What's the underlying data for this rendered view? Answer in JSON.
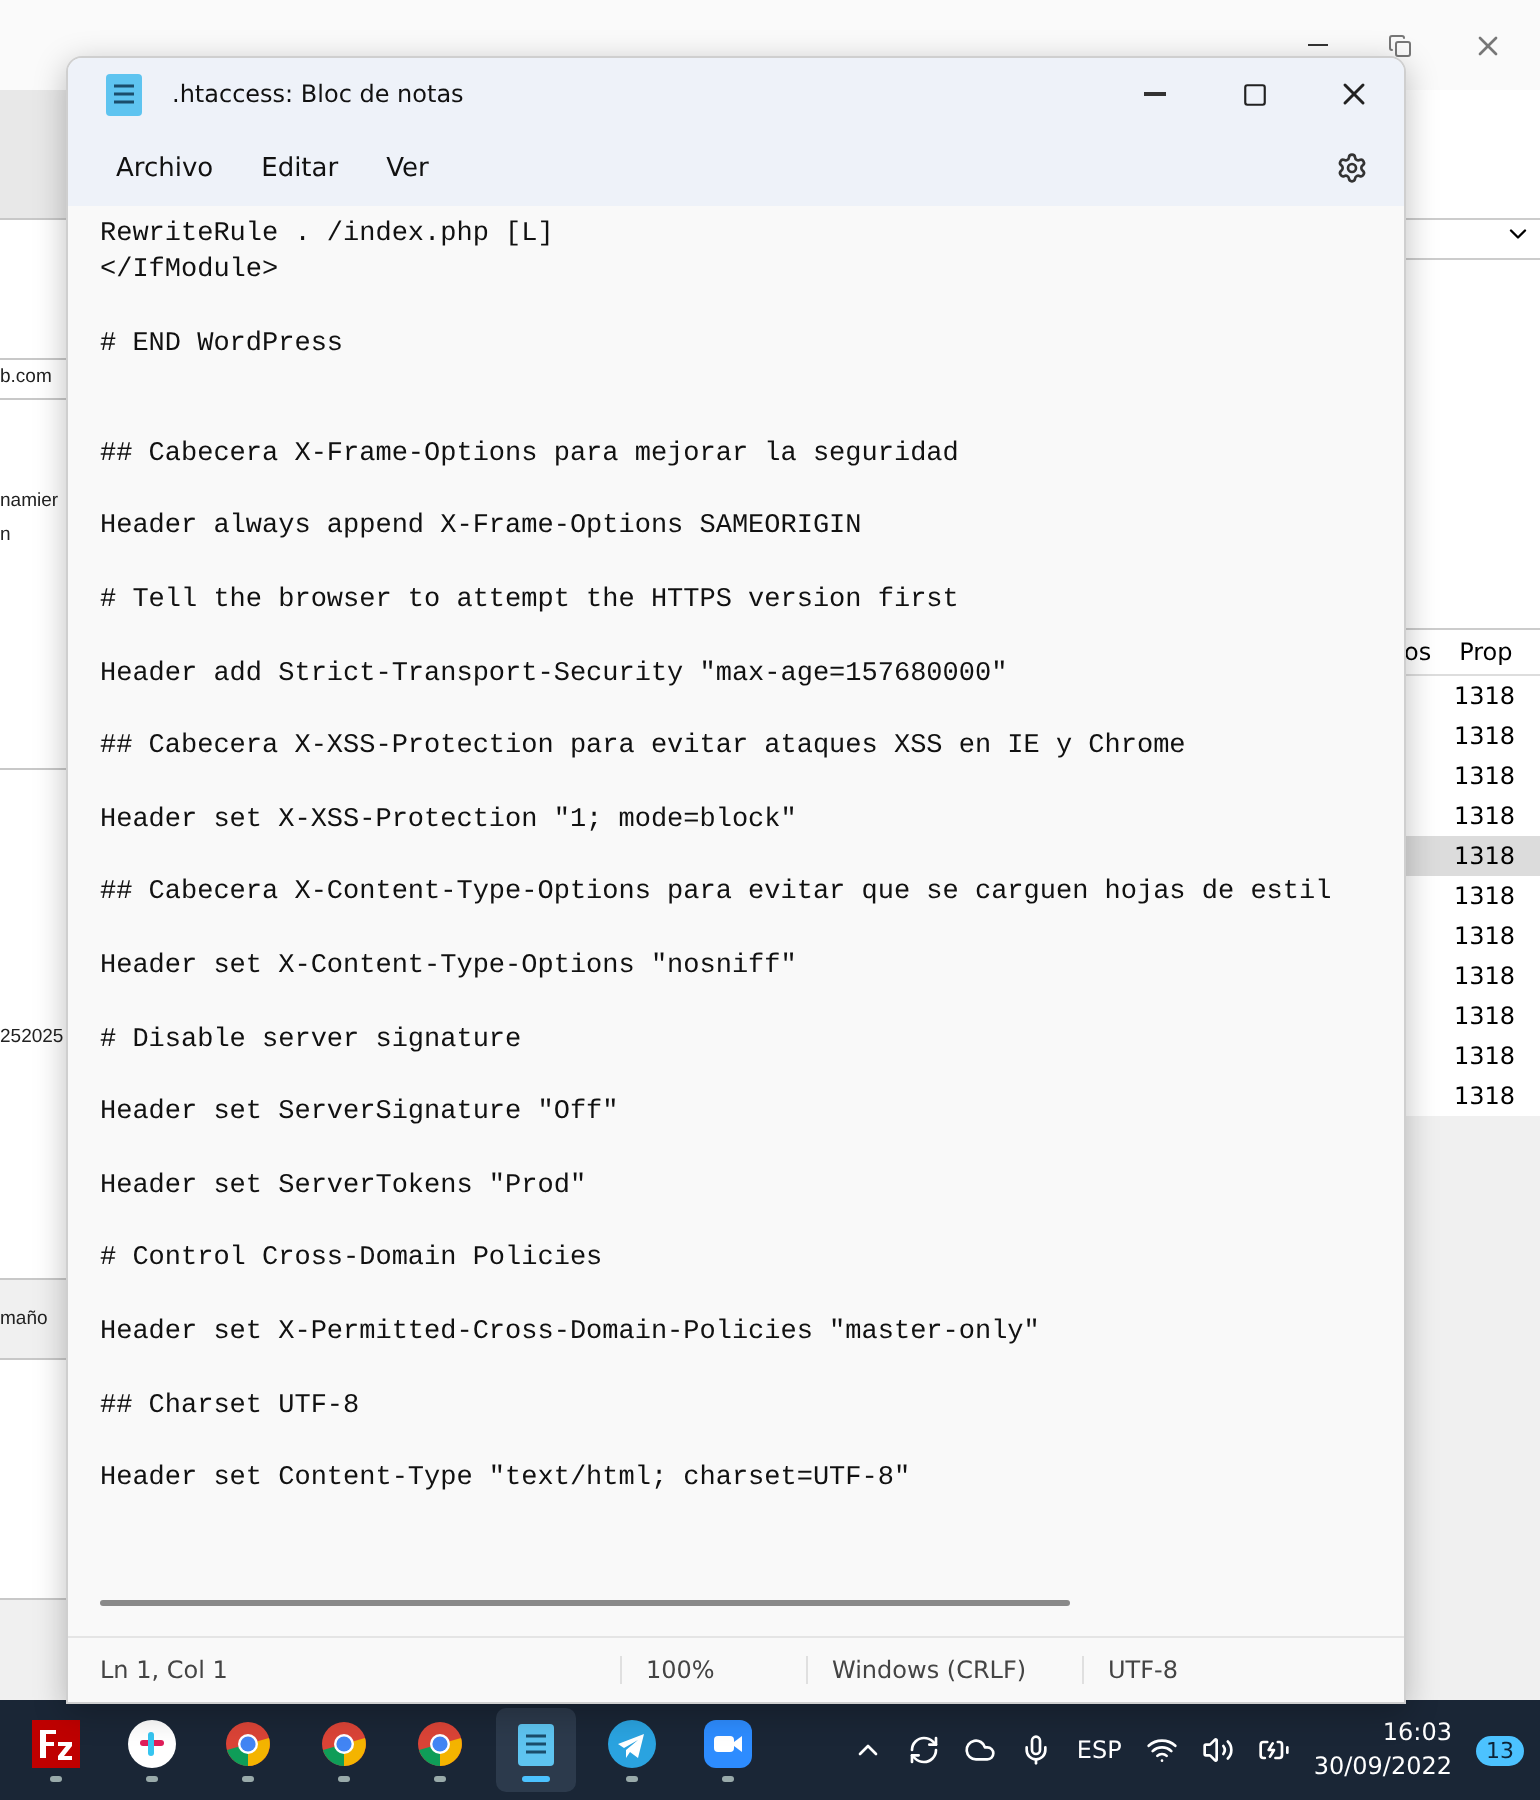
{
  "background_window": {
    "left_texts": [
      "b.com",
      "namier",
      "n",
      "252025",
      "maño"
    ],
    "right_header": [
      "os",
      "Prop"
    ],
    "right_rows": [
      {
        "text": "1318",
        "selected": false
      },
      {
        "text": "1318",
        "selected": false
      },
      {
        "text": "1318",
        "selected": false
      },
      {
        "text": "1318",
        "selected": false
      },
      {
        "text": "1318",
        "selected": true
      },
      {
        "text": "1318",
        "selected": false
      },
      {
        "text": "1318",
        "selected": false
      },
      {
        "text": "1318",
        "selected": false
      },
      {
        "text": "1318",
        "selected": false
      },
      {
        "text": "1318",
        "selected": false
      },
      {
        "text": "1318",
        "selected": false
      }
    ]
  },
  "window": {
    "title": ".htaccess: Bloc de notas"
  },
  "menu": [
    "Archivo",
    "Editar",
    "Ver"
  ],
  "content": "RewriteRule . /index.php [L]\n</IfModule>\n\n# END WordPress\n\n\n## Cabecera X-Frame-Options para mejorar la seguridad\n\nHeader always append X-Frame-Options SAMEORIGIN\n\n# Tell the browser to attempt the HTTPS version first\n\nHeader add Strict-Transport-Security \"max-age=157680000\"\n\n## Cabecera X-XSS-Protection para evitar ataques XSS en IE y Chrome\n\nHeader set X-XSS-Protection \"1; mode=block\"\n\n## Cabecera X-Content-Type-Options para evitar que se carguen hojas de estil\n\nHeader set X-Content-Type-Options \"nosniff\"\n\n# Disable server signature\n\nHeader set ServerSignature \"Off\"\n\nHeader set ServerTokens \"Prod\"\n\n# Control Cross-Domain Policies\n\nHeader set X-Permitted-Cross-Domain-Policies \"master-only\"\n\n## Charset UTF-8\n\nHeader set Content-Type \"text/html; charset=UTF-8\"",
  "status_bar": [
    "Ln 1, Col 1",
    "100%",
    "Windows (CRLF)",
    "UTF-8"
  ],
  "taskbar": {
    "apps": [
      {
        "kind": "filezilla",
        "selected": false
      },
      {
        "kind": "slack",
        "selected": false
      },
      {
        "kind": "chrome",
        "selected": false
      },
      {
        "kind": "chrome",
        "selected": false
      },
      {
        "kind": "chrome",
        "selected": false
      },
      {
        "kind": "notepad",
        "selected": true
      },
      {
        "kind": "telegram",
        "selected": false
      },
      {
        "kind": "zoom",
        "selected": false
      }
    ],
    "language": "ESP",
    "time": "16:03",
    "date": "30/09/2022",
    "notifications": "13"
  }
}
